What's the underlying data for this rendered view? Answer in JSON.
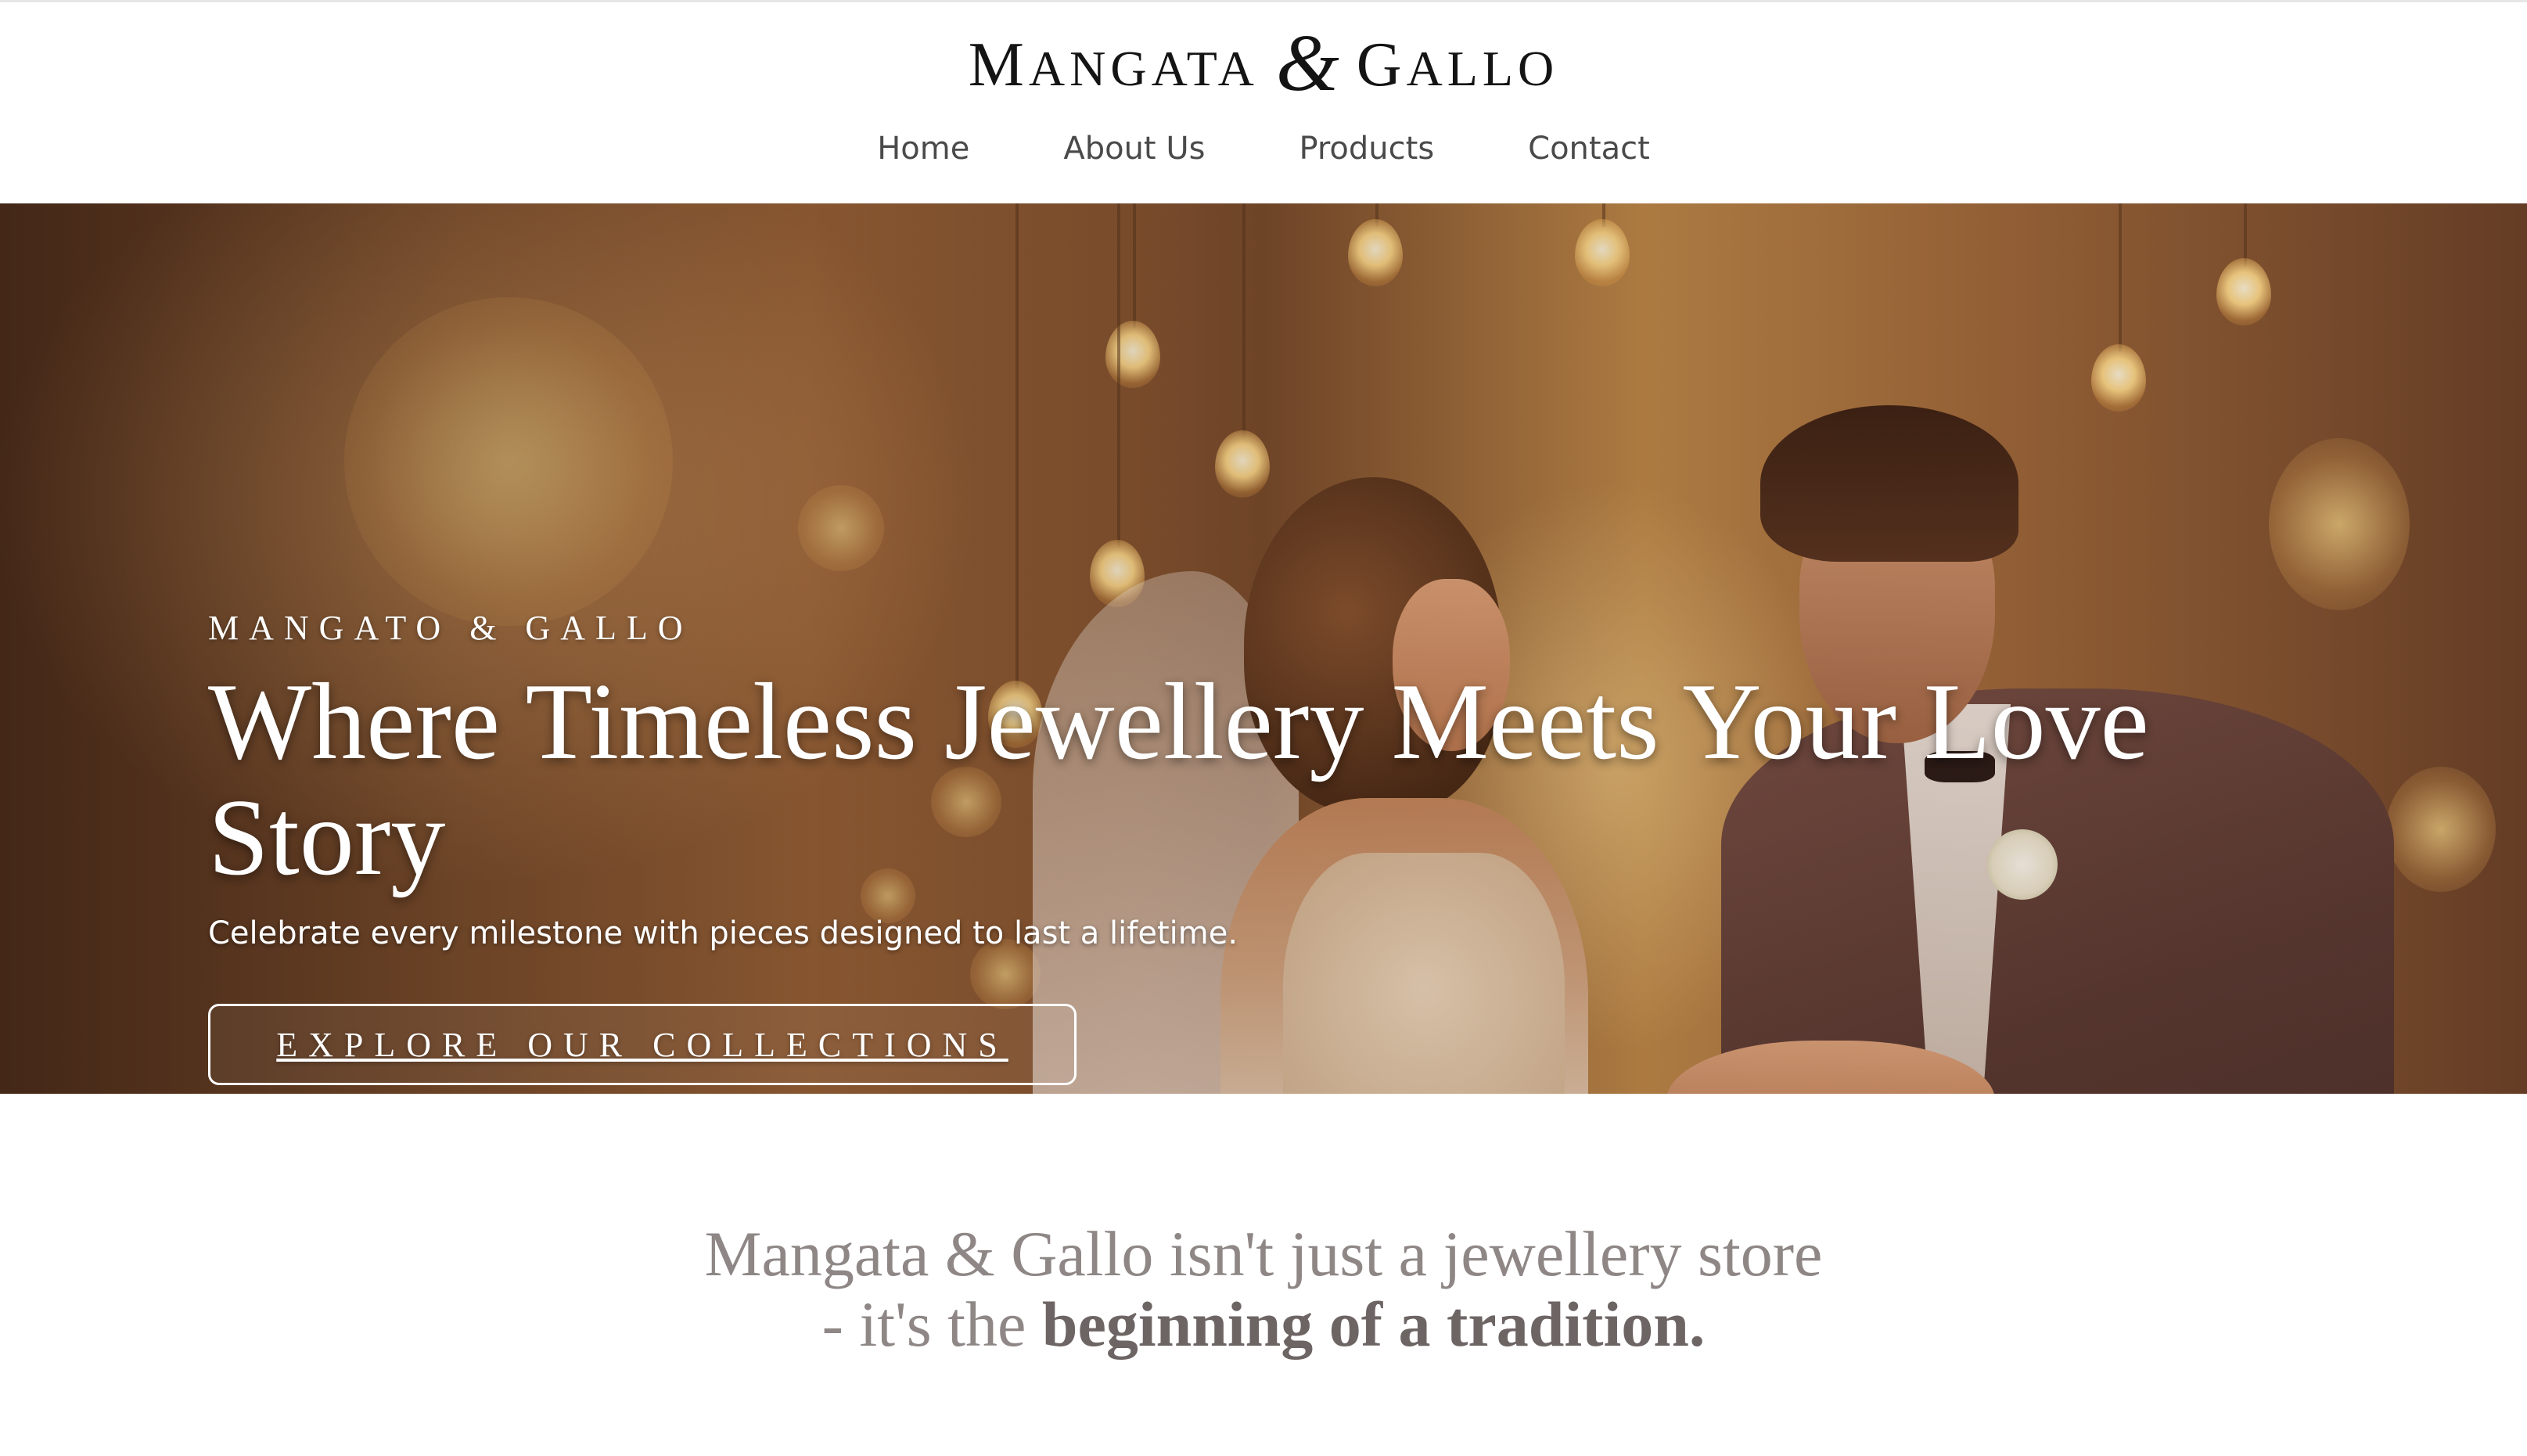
{
  "brand": {
    "logo_part1": "Mangata",
    "logo_amp": "&",
    "logo_part2": "Gallo"
  },
  "nav": {
    "items": [
      "Home",
      "About Us",
      "Products",
      "Contact"
    ]
  },
  "hero": {
    "eyebrow": "MANGATO & GALLO",
    "headline": "Where Timeless Jewellery Meets Your Love Story",
    "subline": "Celebrate every milestone with pieces designed to last a lifetime.",
    "cta_label": "EXPLORE OUR COLLECTIONS",
    "image_alt": "bride-and-groom-ring-exchange"
  },
  "intro": {
    "text_regular": "Mangata & Gallo isn't just a jewellery store - it's the ",
    "text_bold": "beginning of a tradition."
  },
  "colors": {
    "logo": "#141414",
    "nav_text": "#4a4a4a",
    "hero_text": "#ffffff",
    "intro_regular": "#8e8786",
    "intro_bold": "#6d6564"
  }
}
